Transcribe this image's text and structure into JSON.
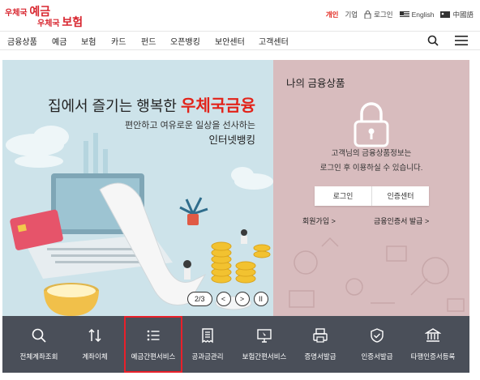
{
  "logo": {
    "line1_small": "우체국",
    "line1_big": "예금",
    "line2_small": "우체국",
    "line2_big": "보험"
  },
  "utils": {
    "personal": "개인",
    "corporate": "기업",
    "login": "로그인",
    "english": "English",
    "chinese": "中國語"
  },
  "nav": {
    "items": [
      "금융상품",
      "예금",
      "보험",
      "카드",
      "펀드",
      "오픈뱅킹",
      "보안센터",
      "고객센터"
    ]
  },
  "banner": {
    "title_prefix": "집에서 즐기는 행복한",
    "title_highlight": "우체국금융",
    "subtitle1": "편안하고 여유로운 일상을 선사하는",
    "subtitle2": "인터넷뱅킹",
    "pager": "2/3",
    "prev": "<",
    "next": ">",
    "pause": "II"
  },
  "my_products": {
    "heading": "나의 금융상품",
    "message1": "고객님의 금융상품정보는",
    "message2": "로그인 후 이용하실 수 있습니다.",
    "login_button": "로그인",
    "cert_button": "인증센터",
    "join_link": "회원가입 >",
    "cert_issue_link": "금융인증서 발급 >"
  },
  "quick_menu": {
    "items": [
      {
        "label": "전체계좌조회",
        "icon": "search-icon"
      },
      {
        "label": "계좌이체",
        "icon": "transfer-arrows-icon"
      },
      {
        "label": "예금간편서비스",
        "icon": "list-icon"
      },
      {
        "label": "공과금관리",
        "icon": "receipt-icon"
      },
      {
        "label": "보험간편서비스",
        "icon": "monitor-icon"
      },
      {
        "label": "증명서발급",
        "icon": "printer-icon"
      },
      {
        "label": "인증서발급",
        "icon": "shield-check-icon"
      },
      {
        "label": "타행인증서등록",
        "icon": "bank-icon"
      }
    ],
    "selected_index": 2
  },
  "colors": {
    "accent": "#e2231a",
    "banner_bg": "#cde3ea",
    "myprod_bg": "#d8bcbe",
    "quick_bg": "#4a4f59",
    "highlight_box": "#e8202a"
  }
}
